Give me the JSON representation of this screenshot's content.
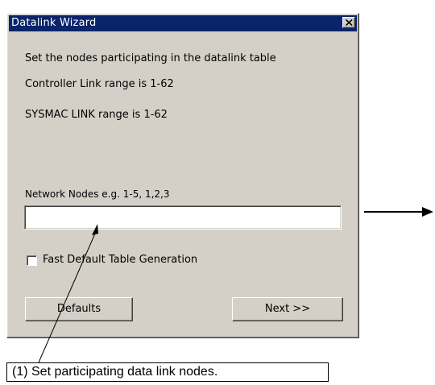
{
  "window": {
    "title": "Datalink Wizard",
    "close_icon": "close-icon"
  },
  "instructions": {
    "line1": "Set the nodes participating in the datalink table",
    "line2": "Controller Link range is 1-62",
    "line3": "SYSMAC LINK range is 1-62"
  },
  "network_nodes": {
    "label": "Network Nodes  e.g. 1-5, 1,2,3",
    "value": ""
  },
  "fast_default": {
    "label": "Fast Default Table Generation",
    "checked": false
  },
  "buttons": {
    "defaults": "Defaults",
    "next": "Next   >>"
  },
  "annotation": {
    "callout": "(1) Set participating data link nodes."
  }
}
